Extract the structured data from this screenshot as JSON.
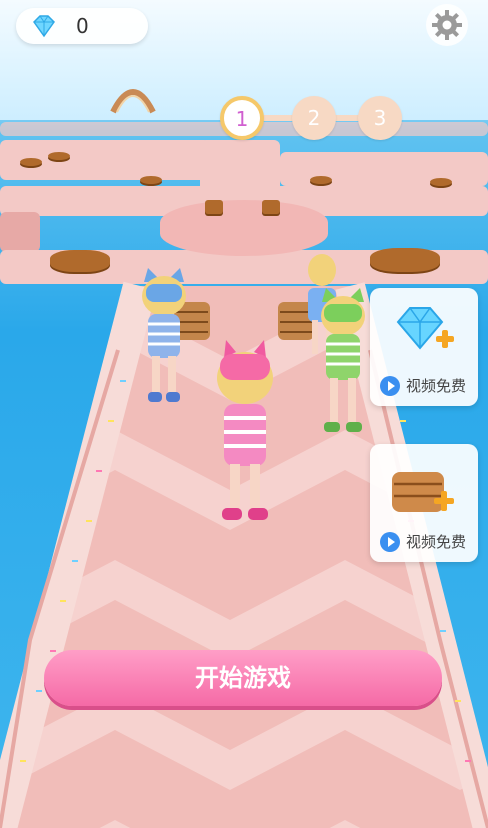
{
  "hud": {
    "gem_icon": "diamond-icon",
    "gem_count": "0",
    "settings_icon": "gear-icon"
  },
  "levels": [
    {
      "label": "1",
      "active": true
    },
    {
      "label": "2",
      "active": false
    },
    {
      "label": "3",
      "active": false
    }
  ],
  "side_offers": [
    {
      "icon": "diamond-plus-icon",
      "label": "视频免费"
    },
    {
      "icon": "wafer-plus-icon",
      "label": "视频免费"
    }
  ],
  "start_button": {
    "label": "开始游戏"
  },
  "colors": {
    "accent_pink": "#f56aa6",
    "level_active_ring": "#f5c86a",
    "level_active_text": "#d05fd0",
    "video_play": "#3a8ff0"
  }
}
